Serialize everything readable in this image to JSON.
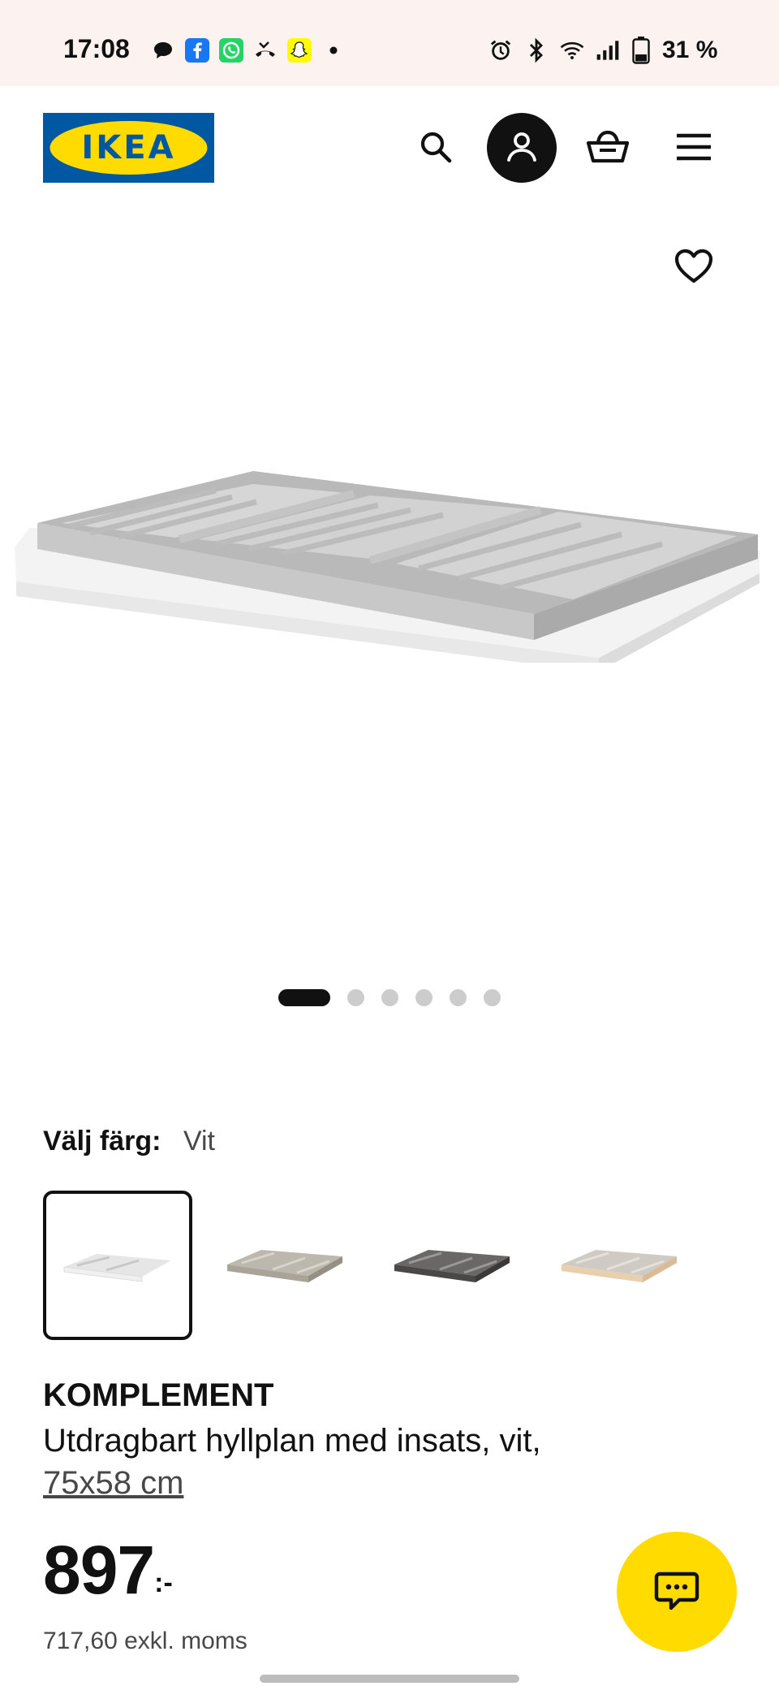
{
  "status_bar": {
    "time": "17:08",
    "battery": "31 %",
    "icons_left": [
      "chat-bubble-icon",
      "facebook-icon",
      "whatsapp-icon",
      "missed-call-icon",
      "snapchat-icon",
      "dot-icon"
    ],
    "icons_right": [
      "alarm-icon",
      "bluetooth-icon",
      "wifi-icon",
      "signal-icon",
      "battery-icon"
    ]
  },
  "header": {
    "logo_text": "IKEA",
    "icons": [
      "search-icon",
      "account-icon",
      "cart-icon",
      "menu-icon"
    ]
  },
  "gallery": {
    "image_count": 6,
    "active_index": 0
  },
  "color_select": {
    "label": "Välj färg:",
    "value": "Vit",
    "selected_index": 0
  },
  "product": {
    "brand": "KOMPLEMENT",
    "description": "Utdragbart hyllplan med insats, vit,",
    "size": "75x58 cm",
    "price_integer": "897",
    "price_suffix": ":-",
    "price_excl": "717,60 exkl. moms"
  },
  "colors": {
    "ikea_blue": "#0058a3",
    "ikea_yellow": "#ffdb00",
    "text_dark": "#111111",
    "text_muted": "#484848"
  }
}
